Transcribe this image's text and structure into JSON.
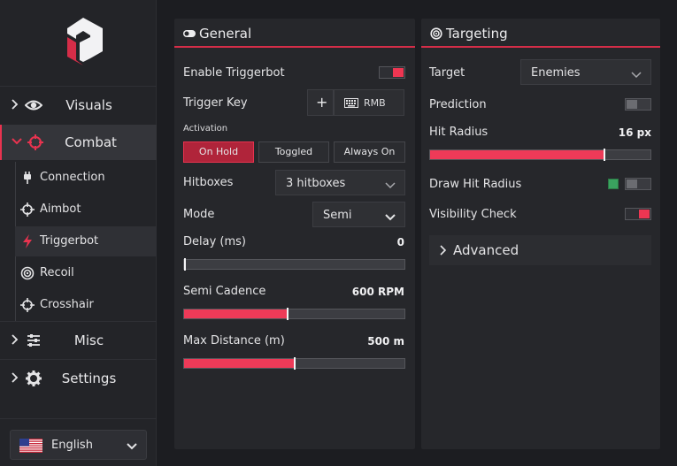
{
  "sidebar": {
    "nav": [
      {
        "label": "Visuals",
        "icon": "eye-icon",
        "expanded": false
      },
      {
        "label": "Combat",
        "icon": "crosshair-icon",
        "expanded": true
      },
      {
        "label": "Misc",
        "icon": "sliders-icon",
        "expanded": false
      },
      {
        "label": "Settings",
        "icon": "gear-icon",
        "expanded": false
      }
    ],
    "combat_items": [
      {
        "label": "Connection",
        "icon": "plug-icon"
      },
      {
        "label": "Aimbot",
        "icon": "crosshair-icon"
      },
      {
        "label": "Triggerbot",
        "icon": "lightning-icon",
        "active": true
      },
      {
        "label": "Recoil",
        "icon": "target-icon"
      },
      {
        "label": "Crosshair",
        "icon": "crosshair-icon"
      }
    ],
    "language": {
      "label": "English",
      "flag": "us-flag-icon"
    }
  },
  "general": {
    "title": "General",
    "enable_triggerbot": {
      "label": "Enable Triggerbot",
      "on": true
    },
    "trigger_key": {
      "label": "Trigger Key",
      "add": "+",
      "key": "RMB"
    },
    "activation": {
      "label": "Activation",
      "options": [
        "On Hold",
        "Toggled",
        "Always On"
      ],
      "selected": "On Hold"
    },
    "hitboxes": {
      "label": "Hitboxes",
      "value": "3 hitboxes"
    },
    "mode": {
      "label": "Mode",
      "value": "Semi"
    },
    "delay": {
      "label": "Delay (ms)",
      "value": "0",
      "fraction": 0.0
    },
    "semi_cadence": {
      "label": "Semi Cadence",
      "value": "600 RPM",
      "fraction": 0.47
    },
    "max_distance": {
      "label": "Max Distance (m)",
      "value": "500 m",
      "fraction": 0.5
    }
  },
  "targeting": {
    "title": "Targeting",
    "target": {
      "label": "Target",
      "value": "Enemies"
    },
    "prediction": {
      "label": "Prediction",
      "on": false
    },
    "hit_radius": {
      "label": "Hit Radius",
      "value": "16 px",
      "fraction": 0.79
    },
    "draw_hit_radius": {
      "label": "Draw Hit Radius",
      "on": false,
      "color": "#3aa35f"
    },
    "visibility_check": {
      "label": "Visibility Check",
      "on": true
    },
    "advanced": {
      "label": "Advanced"
    }
  },
  "colors": {
    "accent": "#e8334f",
    "background": "#1c1d21",
    "panel": "#26272b"
  }
}
